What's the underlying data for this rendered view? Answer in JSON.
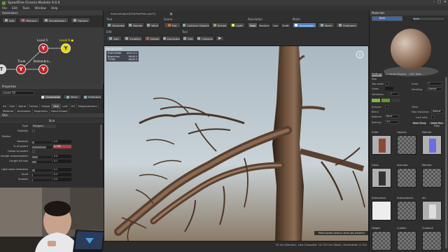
{
  "window": {
    "title": "SpeedTree Cinema Modeler 9.0.0",
    "controls": [
      "–",
      "□",
      "✕"
    ]
  },
  "menu": [
    "File",
    "Edit",
    "Tools",
    "Window",
    "Help"
  ],
  "toolbar": {
    "tree_name": "SearchSubject[FirePinePole.spm*]",
    "groups": {
      "tree": "Tree",
      "scene": "Scene",
      "resolution": "Resolution",
      "mode": "Mode",
      "edit": "Edit",
      "tool": "Tool"
    },
    "row1": [
      "Generate",
      "Render",
      "Wind",
      "Fire",
      "Collision Objects",
      "Terrain",
      "Light"
    ],
    "resolution_buttons": [
      "High",
      "Medium",
      "Low",
      "Draft"
    ],
    "mode_buttons": [
      "Generation",
      "Mesh",
      "Freehand"
    ],
    "row2": [
      "Add",
      "Visibility",
      "Delete",
      "Duplicate",
      "Reparent"
    ],
    "tool_buttons": [
      "Edit",
      "Collision"
    ]
  },
  "generators_panel": {
    "header": "Generators",
    "tools": [
      "Add",
      "Remove",
      "Visualization",
      "Options"
    ],
    "nodes": [
      {
        "label": "Level 5",
        "icon": "Y",
        "state": "normal"
      },
      {
        "label": "Level 6 ●",
        "icon": "Y",
        "state": "selected"
      },
      {
        "label": "Trunk",
        "icon": "Y",
        "state": "normal"
      },
      {
        "label": "Brokenbra...",
        "icon": "Y",
        "state": "normal"
      },
      {
        "label": "Tree",
        "icon": "T",
        "state": "root"
      }
    ]
  },
  "properties_panel": {
    "header": "Properties",
    "generator_name": "Level 10",
    "mode_buttons": [
      "Generation",
      "Mesh",
      "Freehand"
    ],
    "tabs": [
      "All",
      "Gen",
      "Spine",
      "Forces",
      "Shape",
      "Skin",
      "LoD",
      "UV",
      "Displacement",
      "Material",
      "Animation",
      "Segments",
      "Hand Drawn"
    ],
    "section": "Skin",
    "subsection": "Skin",
    "rows": [
      {
        "label": "Type",
        "value": "Polygons"
      },
      {
        "label": "Visibility",
        "value": ""
      },
      {
        "label": "Radius",
        "value": ""
      },
      {
        "label": "Absolute",
        "value": "0.0"
      },
      {
        "label": "% of parent",
        "value": "0.736"
      },
      {
        "label": "Clamp to parent",
        "value": ""
      },
      {
        "label": "Length compensation",
        "value": "0.0"
      },
      {
        "label": "Length kill size",
        "value": "0.1"
      },
      {
        "label": "Light seam reduction",
        "value": "0.1"
      },
      {
        "label": "Scuff",
        "value": "0.0"
      },
      {
        "label": "Smooth",
        "value": "0.0"
      }
    ]
  },
  "viewport": {
    "label": "perspective",
    "stats": [
      {
        "key": "POLYGONS",
        "value": "493,711"
      },
      {
        "key": "Branches",
        "value": "96,613"
      },
      {
        "key": "TOTAL",
        "value": "96,613"
      }
    ],
    "note": "Mesh-based (branch-level ops present)",
    "status": "52 ms (Render), Last Compute: 14,720 ms (Total), Generation (1.33)"
  },
  "materials_panel": {
    "header": "Materials",
    "selected": "Bark",
    "dropdown": "Bark",
    "tabs": [
      "Settings",
      "Compute Display",
      "LOD Tools"
    ],
    "rows": [
      {
        "label": "Map",
        "value": ""
      },
      {
        "label": "Two-sided",
        "value": ""
      },
      {
        "label": "Scale",
        "value": "1"
      },
      {
        "label": "Handling",
        "value": "Default"
      },
      {
        "label": "Variations",
        "value": "1"
      },
      {
        "label": "Amount",
        "value": ""
      },
      {
        "label": "Blend",
        "value": ""
      },
      {
        "label": "Material",
        "value": "None"
      },
      {
        "label": "Spacing",
        "value": "0.0"
      },
      {
        "label": "Other",
        "value": ""
      },
      {
        "label": "Max resolution",
        "value": "Default"
      },
      {
        "label": "Lock ratio",
        "value": ""
      }
    ],
    "buttons": [
      "Make Tiling",
      "Make Res Grey"
    ],
    "textures": [
      {
        "label": "Color"
      },
      {
        "label": "Opacity"
      },
      {
        "label": "Normal"
      },
      {
        "label": "Gloss"
      },
      {
        "label": "Specular"
      },
      {
        "label": "Metallic"
      },
      {
        "label": "Subsurface"
      },
      {
        "label": "Subsurface%"
      },
      {
        "label": "AO"
      },
      {
        "label": "Height"
      },
      {
        "label": "Custom"
      },
      {
        "label": "Custom2"
      }
    ],
    "colors": {
      "accent": "#3b68a8",
      "swatch_green": "#7ab840",
      "swatch_green2": "#5c9a30",
      "generation_accent": "#4d7fbf"
    }
  }
}
